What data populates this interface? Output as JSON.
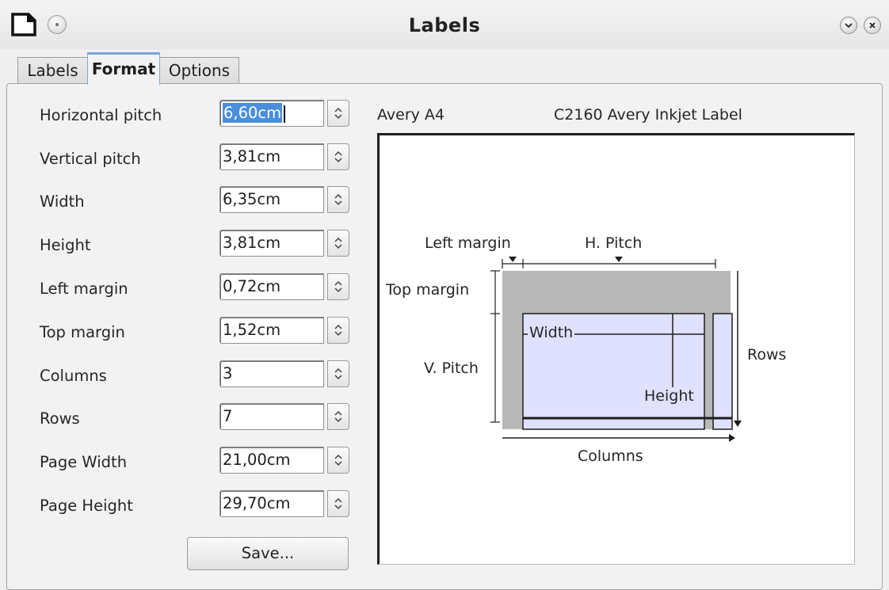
{
  "window": {
    "title": "Labels"
  },
  "tabs": [
    {
      "label": "Labels",
      "active": false
    },
    {
      "label": "Format",
      "active": true
    },
    {
      "label": "Options",
      "active": false
    }
  ],
  "fields": [
    {
      "label": "Horizontal pitch",
      "value": "6,60cm",
      "selected": true
    },
    {
      "label": "Vertical pitch",
      "value": "3,81cm"
    },
    {
      "label": "Width",
      "value": "6,35cm"
    },
    {
      "label": "Height",
      "value": "3,81cm"
    },
    {
      "label": "Left margin",
      "value": "0,72cm"
    },
    {
      "label": "Top margin",
      "value": "1,52cm"
    },
    {
      "label": "Columns",
      "value": "3"
    },
    {
      "label": "Rows",
      "value": "7"
    },
    {
      "label": "Page Width",
      "value": "21,00cm"
    },
    {
      "label": "Page Height",
      "value": "29,70cm"
    }
  ],
  "save_label": "Save...",
  "preview": {
    "brand": "Avery A4",
    "type": "C2160 Avery Inkjet Label",
    "labels": {
      "left_margin": "Left margin",
      "h_pitch": "H. Pitch",
      "top_margin": "Top margin",
      "width": "Width",
      "v_pitch": "V. Pitch",
      "height": "Height",
      "rows": "Rows",
      "columns": "Columns"
    }
  },
  "colors": {
    "label_fill": "#e0e0ff",
    "margin_fill": "#b8b8b8",
    "accent": "#4a8edc"
  }
}
